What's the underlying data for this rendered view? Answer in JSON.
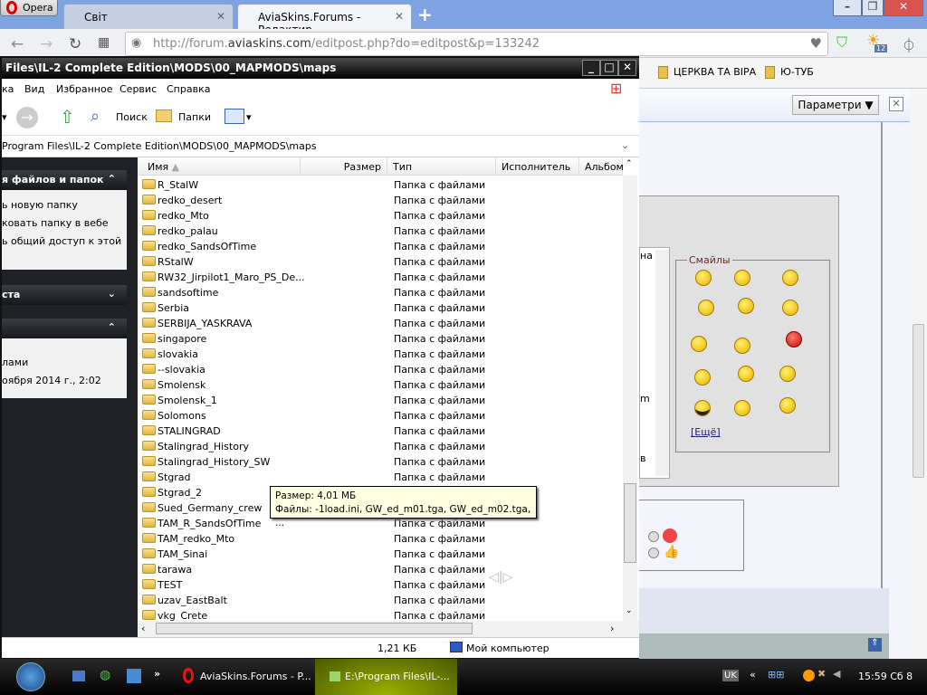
{
  "browser": {
    "opera_label": "Opera",
    "tabs": [
      {
        "label": "Світ"
      },
      {
        "label": "AviaSkins.Forums - Редактир"
      }
    ],
    "url_prefix": "http://forum.",
    "url_domain": "aviaskins.com",
    "url_path": "/editpost.php?do=editpost&p=133242",
    "badge": "12",
    "bookmarks": [
      "ЦЕРКВА ТА ВІРА",
      "Ю-ТУБ"
    ],
    "options_button": "Параметри ▼"
  },
  "forum": {
    "smilies_legend": "Смайлы",
    "more_link": "[Ещё]",
    "fragments": [
      "на",
      "m",
      "в"
    ]
  },
  "explorer": {
    "title": "Files\\IL-2 Complete Edition\\MODS\\00_MAPMODS\\maps",
    "menu": [
      "ка",
      "Вид",
      "Избранное",
      "Сервис",
      "Справка"
    ],
    "toolbar": {
      "search": "Поиск",
      "folders": "Папки"
    },
    "address": "Program Files\\IL-2 Complete Edition\\MODS\\00_MAPMODS\\maps",
    "left_pane": {
      "tasks_header": "я файлов и папок",
      "tasks": [
        "ь новую папку",
        "ковать папку в вебе",
        "ь общий доступ к этой"
      ],
      "places_header": "ста",
      "details_lines": [
        "лами",
        "оября 2014 г., 2:02"
      ]
    },
    "columns": [
      "Имя",
      "Размер",
      "Тип",
      "Исполнитель",
      "Альбом"
    ],
    "type_label": "Папка с файлами",
    "files": [
      "R_StalW",
      "redko_desert",
      "redko_Mto",
      "redko_palau",
      "redko_SandsOfTime",
      "RStalW",
      "RW32_Jirpilot1_Maro_PS_De...",
      "sandsoftime",
      "Serbia",
      "SERBIJA_YASKRAVA",
      "singapore",
      "slovakia",
      "--slovakia",
      "Smolensk",
      "Smolensk_1",
      "Solomons",
      "STALINGRAD",
      "Stalingrad_History",
      "Stalingrad_History_SW",
      "Stgrad",
      "Stgrad_2",
      "Sued_Germany_crew",
      "TAM_R_SandsOfTime",
      "TAM_redko_Mto",
      "TAM_Sinai",
      "tarawa",
      "TEST",
      "uzav_EastBalt",
      "vkg_Crete"
    ],
    "tooltip": {
      "line1": "Размер: 4,01 МБ",
      "line2": "Файлы: -1load.ini, GW_ed_m01.tga, GW_ed_m02.tga, ..."
    },
    "status": {
      "size": "1,21 КБ",
      "location": "Мой компьютер"
    }
  },
  "taskbar": {
    "items": [
      "AviaSkins.Forums - P...",
      "E:\\Program Files\\IL-..."
    ],
    "lang": "UK",
    "clock": "15:59 Сб 8"
  }
}
